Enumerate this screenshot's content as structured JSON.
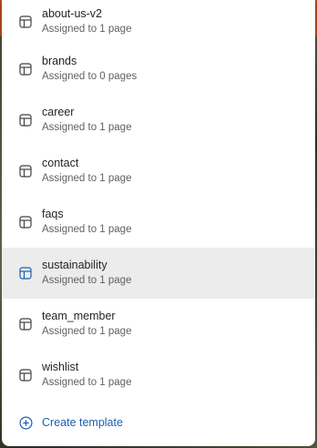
{
  "colors": {
    "accent": "#1a5fb4",
    "selected_bg": "#ececec",
    "text_primary": "#242424",
    "text_secondary": "#616161"
  },
  "templates": [
    {
      "name": "about-us-v2",
      "assigned": "Assigned to 1 page",
      "icon": "template-layout-icon",
      "selected": false
    },
    {
      "name": "brands",
      "assigned": "Assigned to 0 pages",
      "icon": "template-layout-icon",
      "selected": false
    },
    {
      "name": "career",
      "assigned": "Assigned to 1 page",
      "icon": "template-layout-icon",
      "selected": false
    },
    {
      "name": "contact",
      "assigned": "Assigned to 1 page",
      "icon": "template-layout-icon",
      "selected": false
    },
    {
      "name": "faqs",
      "assigned": "Assigned to 1 page",
      "icon": "template-layout-icon",
      "selected": false
    },
    {
      "name": "sustainability",
      "assigned": "Assigned to 1 page",
      "icon": "template-layout-icon",
      "selected": true
    },
    {
      "name": "team_member",
      "assigned": "Assigned to 1 page",
      "icon": "template-layout-icon",
      "selected": false
    },
    {
      "name": "wishlist",
      "assigned": "Assigned to 1 page",
      "icon": "template-layout-icon",
      "selected": false
    }
  ],
  "create": {
    "label": "Create template",
    "icon": "plus-circle-icon"
  }
}
